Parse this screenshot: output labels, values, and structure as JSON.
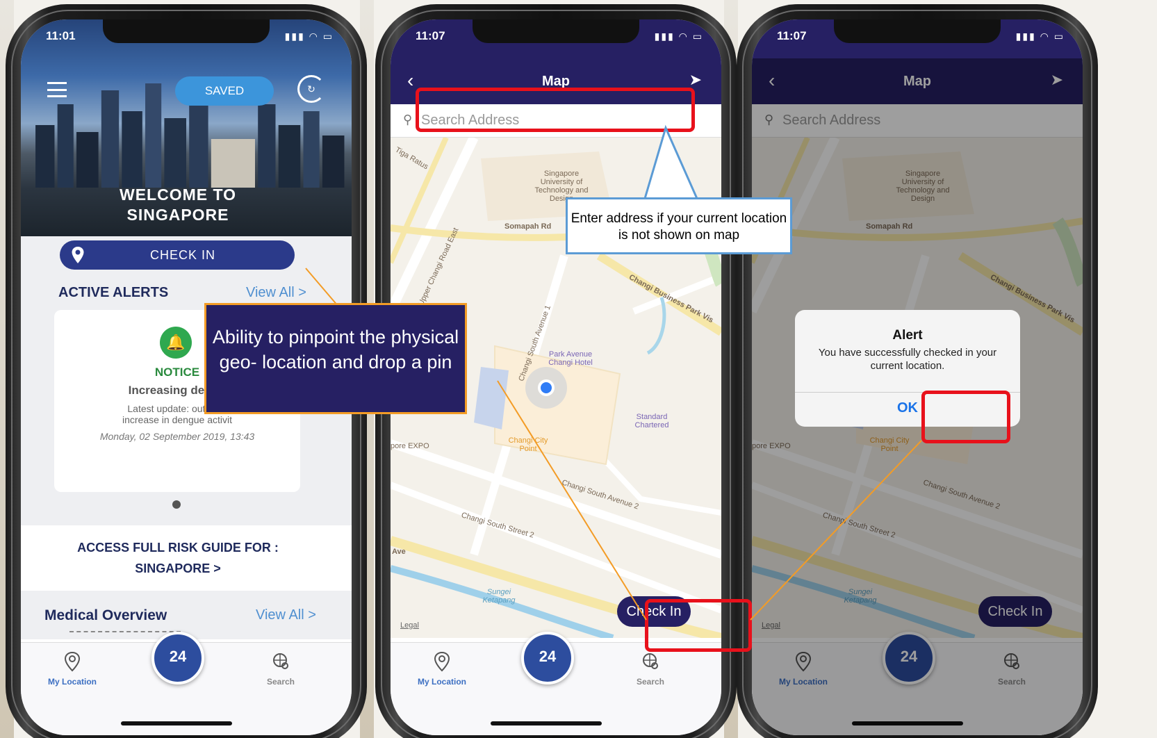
{
  "phone1": {
    "status_time": "11:01",
    "saved_label": "SAVED",
    "welcome_line1": "WELCOME TO",
    "welcome_line2": "SINGAPORE",
    "checkin_label": "CHECK IN",
    "alerts_title": "ACTIVE ALERTS",
    "alerts_view_all": "View All >",
    "alert": {
      "type": "NOTICE",
      "headline": "Increasing dengu",
      "text_line1": "Latest update: outbreal",
      "text_line2": "increase in dengue activit",
      "date": "Monday, 02 September 2019, 13:43"
    },
    "risk_line1": "ACCESS FULL RISK GUIDE FOR :",
    "risk_line2": "SINGAPORE >",
    "medical_title": "Medical Overview",
    "medical_view_all": "View All >",
    "tab_location": "My Location",
    "tab_search": "Search",
    "emergency_label": "24"
  },
  "phone2": {
    "status_time": "11:07",
    "nav_title": "Map",
    "search_placeholder": "Search Address",
    "checkin_button": "Check In",
    "legal": "Legal",
    "tab_location": "My Location",
    "tab_search": "Search",
    "emergency_label": "24"
  },
  "phone3": {
    "status_time": "11:07",
    "nav_title": "Map",
    "search_placeholder": "Search Address",
    "checkin_button": "Check In",
    "legal": "Legal",
    "dialog_title": "Alert",
    "dialog_message": "You have successfully checked in your current location.",
    "dialog_ok": "OK",
    "tab_location": "My Location",
    "tab_search": "Search",
    "emergency_label": "24"
  },
  "map_labels": {
    "sutd": "Singapore University of Technology and Design",
    "somapah": "Somapah Rd",
    "park_avenue": "Park Avenue Changi Hotel",
    "standard_chartered": "Standard Chartered",
    "changi_city_point": "Changi City Point",
    "expo": "pore EXPO",
    "csa2": "Changi South Avenue 2",
    "css2": "Changi South Street 2",
    "sungei": "Sungei Ketapang",
    "tiga_ratus": "Tiga Ratus",
    "upper_changi": "Upper Changi Road East",
    "changi_south_avenue1": "Changi South Avenue 1",
    "business_park": "Changi Business Park Vis",
    "ave": "Ave"
  },
  "annotations": {
    "pinpoint_callout": "Ability to pinpoint the physical geo- location and drop a pin",
    "address_callout": "Enter address if your current location is not shown on map"
  },
  "colors": {
    "navy": "#262063",
    "highlight_red": "#e8111b",
    "callout_orange": "#f39c26",
    "callout_blue": "#5b9bd5",
    "link_blue": "#4f8fd0"
  }
}
